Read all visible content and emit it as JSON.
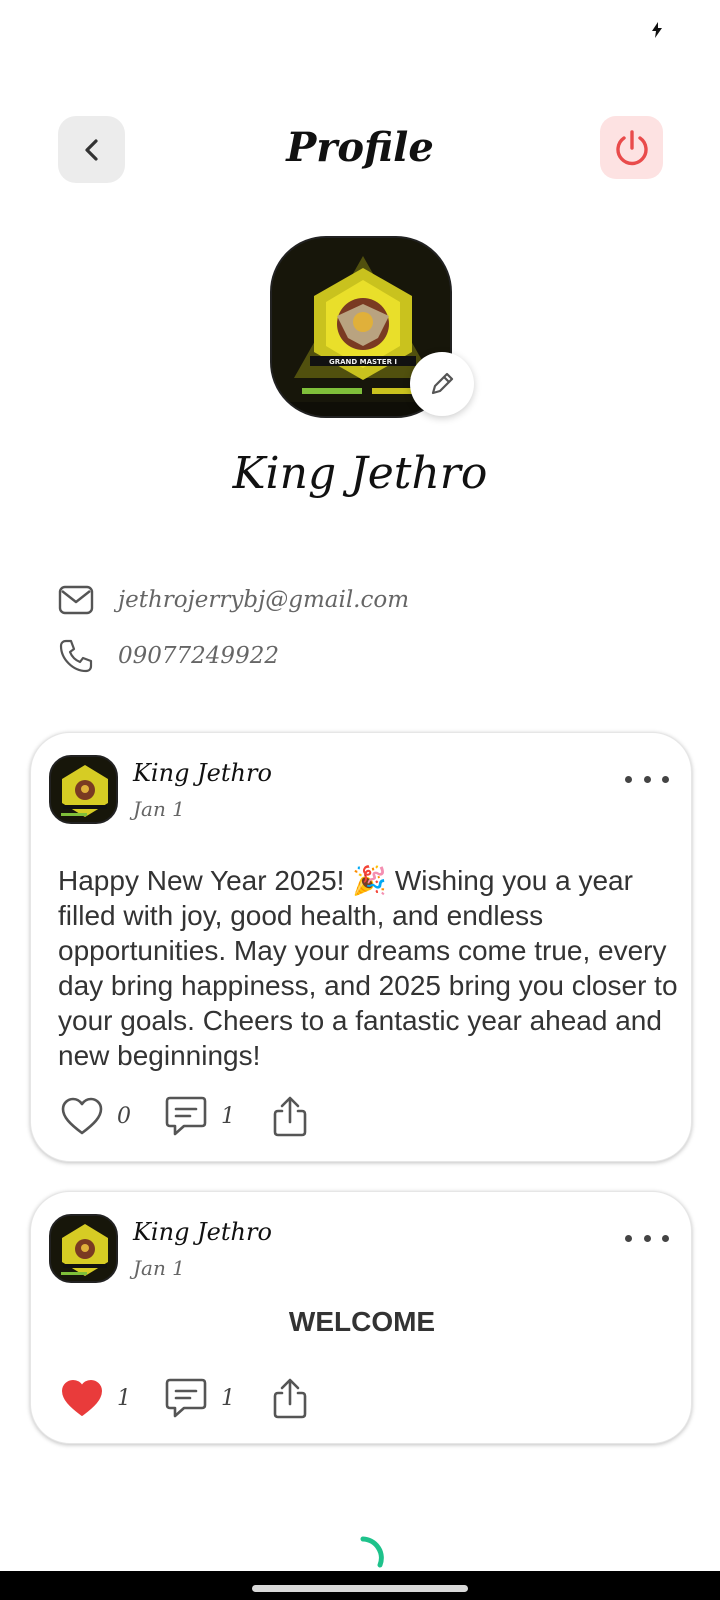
{
  "status_bar": {
    "charging_icon": "bolt-icon"
  },
  "header": {
    "title": "Profile",
    "back_icon": "chevron-left-icon",
    "logout_icon": "power-icon",
    "logout_color": "#e94b4b"
  },
  "profile": {
    "name": "King Jethro",
    "avatar_caption": "GRAND MASTER I",
    "email": "jethrojerrybj@gmail.com",
    "phone": "09077249922",
    "edit_icon": "pencil-icon"
  },
  "posts": [
    {
      "author": "King Jethro",
      "date": "Jan 1",
      "text": "Happy New Year 2025! 🎉 Wishing you a year filled with joy, good health, and endless opportunities. May your dreams come true, every day bring happiness, and 2025 bring you closer to your goals. Cheers to a fantastic year ahead and new beginnings!",
      "likes": "0",
      "comments": "1",
      "liked": false
    },
    {
      "author": "King Jethro",
      "date": "Jan 1",
      "text": "WELCOME",
      "likes": "1",
      "comments": "1",
      "liked": true
    }
  ],
  "colors": {
    "like_active": "#e93b3b",
    "spinner": "#1ec28b",
    "accent_bg": "#fde2e2"
  }
}
